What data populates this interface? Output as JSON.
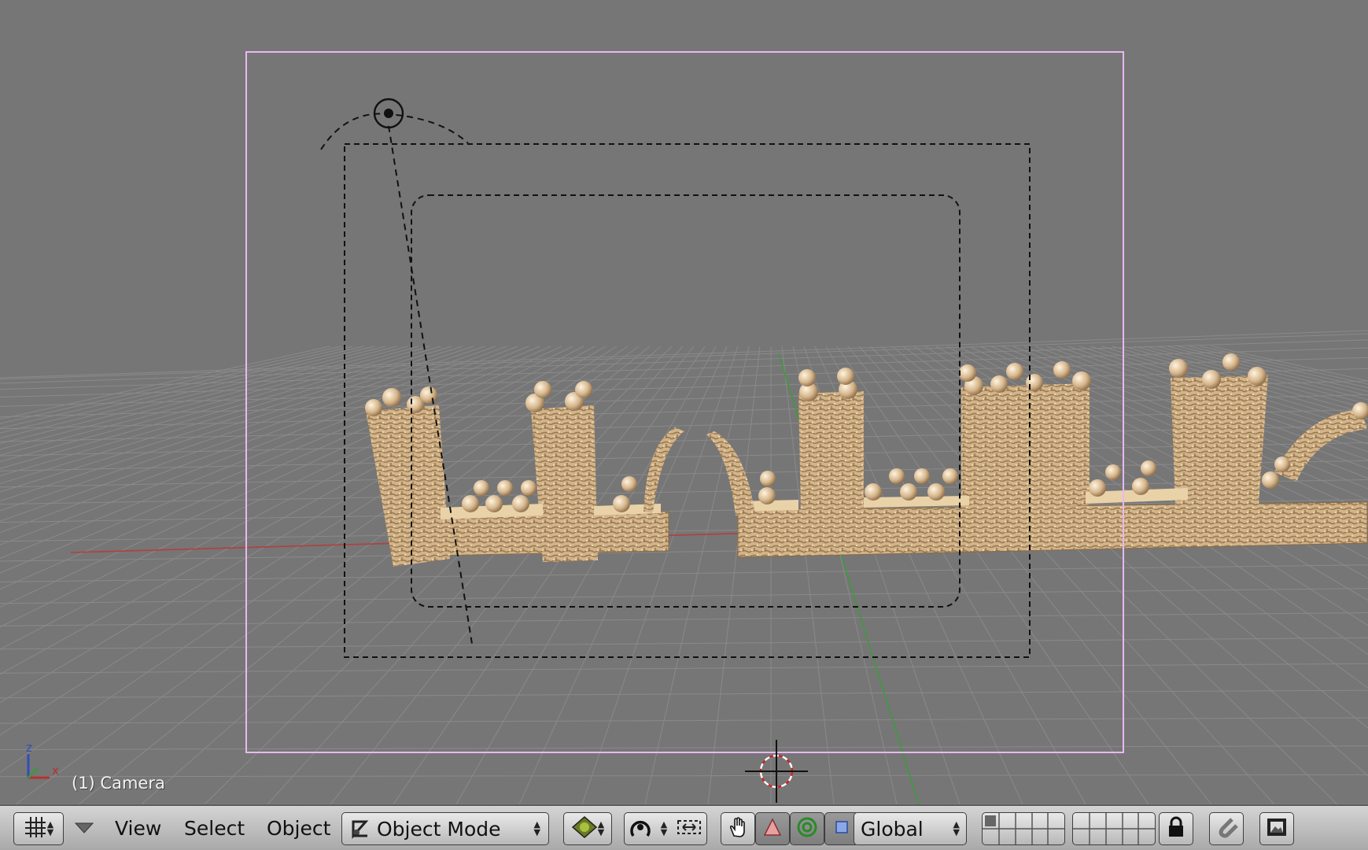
{
  "viewport": {
    "object_label": "(1) Camera",
    "axis_labels": {
      "z": "z",
      "x": "x"
    },
    "colors": {
      "background": "#767676",
      "grid": "#8a8a8a",
      "x_axis": "#b04040",
      "y_axis": "#3e9a3e",
      "camera_border": "#e8b8f0",
      "model": "#d8b88e"
    }
  },
  "header": {
    "editor_type_icon": "grid-icon",
    "menu_toggle_icon": "triangle-down-icon",
    "menus": [
      "View",
      "Select",
      "Object"
    ],
    "mode": {
      "icon": "object-mode-icon",
      "label": "Object Mode"
    },
    "draw_type_icon": "textured-sphere-icon",
    "pivot_icon": "pivot-icon",
    "widget_icon": "widget-icon",
    "manipulator_icons": [
      "hand-icon",
      "translate-icon",
      "rotate-icon",
      "scale-icon"
    ],
    "orientation": "Global",
    "lock_icon": "lock-icon",
    "snap_icon": "magnet-icon",
    "render_icon": "render-icon"
  }
}
